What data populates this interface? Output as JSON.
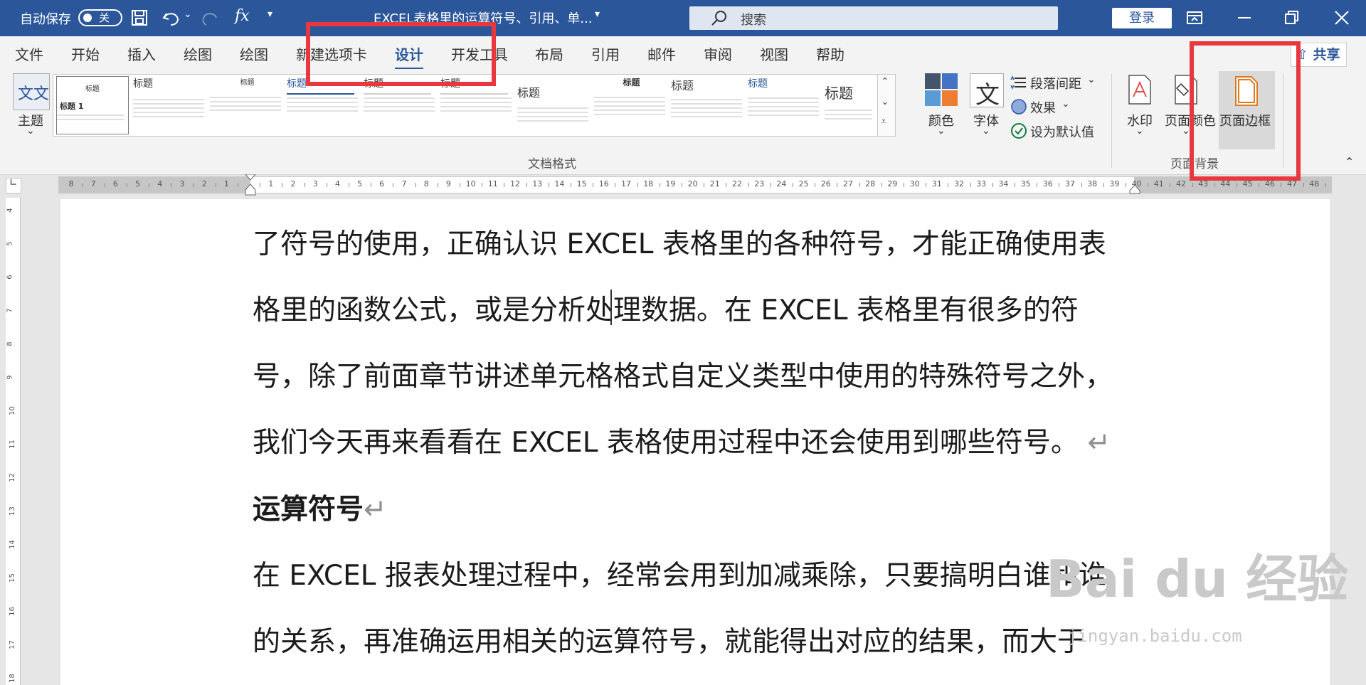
{
  "titlebar": {
    "autosave_label": "自动保存",
    "autosave_state": "关",
    "doc_title": "EXCEL表格里的运算符号、引用、单...",
    "search_placeholder": "搜索",
    "login_label": "登录"
  },
  "tabs": [
    {
      "label": "文件"
    },
    {
      "label": "开始"
    },
    {
      "label": "插入"
    },
    {
      "label": "绘图"
    },
    {
      "label": "绘图"
    },
    {
      "label": "新建选项卡"
    },
    {
      "label": "设计"
    },
    {
      "label": "开发工具"
    },
    {
      "label": "布局"
    },
    {
      "label": "引用"
    },
    {
      "label": "邮件"
    },
    {
      "label": "审阅"
    },
    {
      "label": "视图"
    },
    {
      "label": "帮助"
    }
  ],
  "active_tab": "设计",
  "share_label": "共享",
  "ribbon": {
    "theme_label": "主题",
    "theme_glyph": "文文",
    "gallery_titles": [
      "标题",
      "标题",
      "标题",
      "标题",
      "标题",
      "标题",
      "标题",
      "标题",
      "标题",
      "标题",
      "标题"
    ],
    "gallery_first_heading": "标题 1",
    "colors_label": "颜色",
    "fonts_label": "字体",
    "fonts_glyph": "文",
    "para_spacing_label": "段落间距",
    "effects_label": "效果",
    "set_default_label": "设为默认值",
    "group_doc_format": "文档格式",
    "watermark_label": "水印",
    "page_color_label": "页面颜色",
    "page_border_label": "页面边框",
    "group_page_bg": "页面背景"
  },
  "ruler_numbers": [
    "8",
    "7",
    "6",
    "5",
    "4",
    "3",
    "2",
    "1",
    "",
    "1",
    "2",
    "3",
    "4",
    "5",
    "6",
    "7",
    "8",
    "9",
    "10",
    "11",
    "12",
    "13",
    "14",
    "15",
    "16",
    "17",
    "18",
    "19",
    "20",
    "21",
    "22",
    "23",
    "24",
    "25",
    "26",
    "27",
    "28",
    "29",
    "30",
    "31",
    "32",
    "33",
    "34",
    "35",
    "36",
    "37",
    "38",
    "39",
    "40",
    "41",
    "42",
    "43",
    "44",
    "45",
    "46",
    "47",
    "48"
  ],
  "vruler_numbers": [
    "4",
    "5",
    "6",
    "7",
    "8",
    "9",
    "10",
    "11",
    "12",
    "13",
    "14",
    "15",
    "16",
    "17",
    "18"
  ],
  "document": {
    "line1": "了符号的使用，正确认识 EXCEL 表格里的各种符号，才能正确使用表",
    "line2": "格里的函数公式，或是分析处理数据。在  EXCEL  表格里有很多的符",
    "line3": "号，除了前面章节讲述单元格格式自定义类型中使用的特殊符号之外，",
    "line4": "我们今天再来看看在 EXCEL 表格使用过程中还会使用到哪些符号。",
    "heading": "运算符号",
    "line5": "在 EXCEL 报表处理过程中，经常会用到加减乘除，只要搞明白谁和谁",
    "line6": "的关系，再准确运用相关的运算符号，就能得出对应的结果，而大于"
  },
  "watermark": {
    "logo": "Bai du 经验",
    "url": "jingyan.baidu.com"
  },
  "colors": {
    "accent": "#2b579a",
    "highlight_box": "#e8383d"
  }
}
